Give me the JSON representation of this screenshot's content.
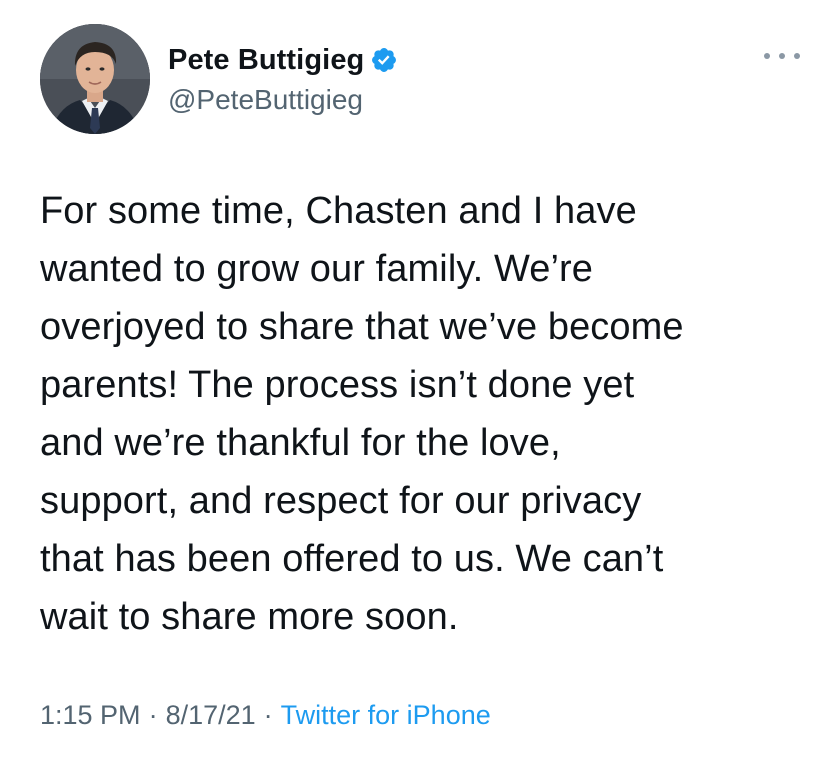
{
  "author": {
    "display_name": "Pete Buttigieg",
    "handle": "@PeteButtigieg",
    "verified": true,
    "verified_badge_color": "#1d9bf0"
  },
  "tweet": {
    "lines": [
      "For some time, Chasten and I have",
      "wanted to grow our family. We’re",
      "overjoyed to share that we’ve become",
      "parents! The process isn’t done yet",
      "and we’re thankful for the love,",
      "support, and respect for our privacy",
      "that has been offered to us. We can’t",
      "wait to share more soon."
    ]
  },
  "meta": {
    "time": "1:15 PM",
    "separator": "·",
    "date": "8/17/21",
    "source": "Twitter for iPhone"
  },
  "icons": {
    "more": "more-options-icon",
    "verified": "verified-badge-icon"
  },
  "colors": {
    "text_primary": "#0f1419",
    "text_secondary": "#536471",
    "link": "#1d9bf0",
    "background": "#ffffff"
  }
}
